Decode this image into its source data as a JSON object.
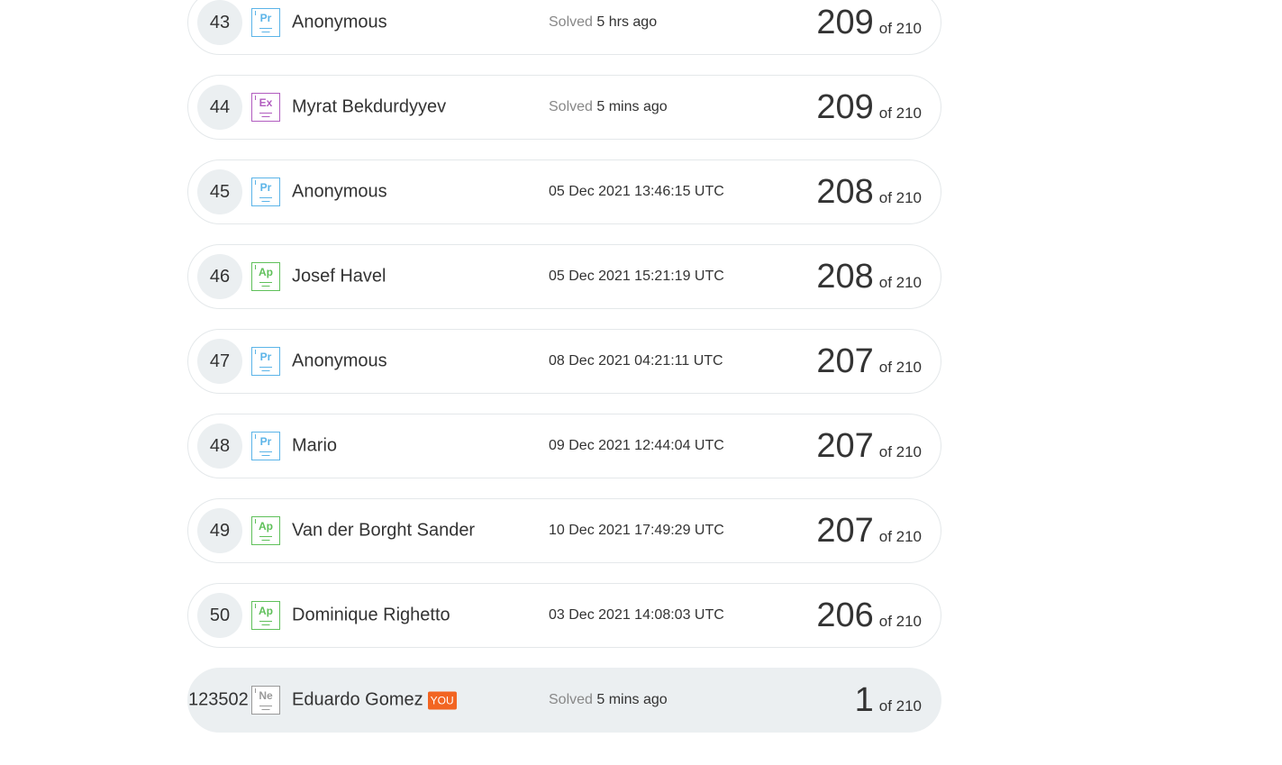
{
  "rows": [
    {
      "rank": "43",
      "badge": "Pr",
      "name": "Anonymous",
      "time_prefix": "Solved",
      "time": "5 hrs ago",
      "score": "209",
      "of": "of 210"
    },
    {
      "rank": "44",
      "badge": "Ex",
      "name": "Myrat Bekdurdyyev",
      "time_prefix": "Solved",
      "time": "5 mins ago",
      "score": "209",
      "of": "of 210"
    },
    {
      "rank": "45",
      "badge": "Pr",
      "name": "Anonymous",
      "time_prefix": "",
      "time": "05 Dec 2021 13:46:15 UTC",
      "score": "208",
      "of": "of 210"
    },
    {
      "rank": "46",
      "badge": "Ap",
      "name": "Josef Havel",
      "time_prefix": "",
      "time": "05 Dec 2021 15:21:19 UTC",
      "score": "208",
      "of": "of 210"
    },
    {
      "rank": "47",
      "badge": "Pr",
      "name": "Anonymous",
      "time_prefix": "",
      "time": "08 Dec 2021 04:21:11 UTC",
      "score": "207",
      "of": "of 210"
    },
    {
      "rank": "48",
      "badge": "Pr",
      "name": "Mario",
      "time_prefix": "",
      "time": "09 Dec 2021 12:44:04 UTC",
      "score": "207",
      "of": "of 210"
    },
    {
      "rank": "49",
      "badge": "Ap",
      "name": "Van der Borght Sander",
      "time_prefix": "",
      "time": "10 Dec 2021 17:49:29 UTC",
      "score": "207",
      "of": "of 210"
    },
    {
      "rank": "50",
      "badge": "Ap",
      "name": "Dominique Righetto",
      "time_prefix": "",
      "time": "03 Dec 2021 14:08:03 UTC",
      "score": "206",
      "of": "of 210"
    }
  ],
  "you_row": {
    "rank": "123502",
    "badge": "Ne",
    "name": "Eduardo Gomez",
    "you_label": "YOU",
    "time_prefix": "Solved",
    "time": "5 mins ago",
    "score": "1",
    "of": "of 210"
  },
  "colors": {
    "accent_you": "#f26522",
    "row_highlight": "#ebeff1",
    "badge_pr": "#5bb4e8",
    "badge_ex": "#b15cbf",
    "badge_ap": "#5fc05a",
    "badge_ne": "#999999"
  }
}
